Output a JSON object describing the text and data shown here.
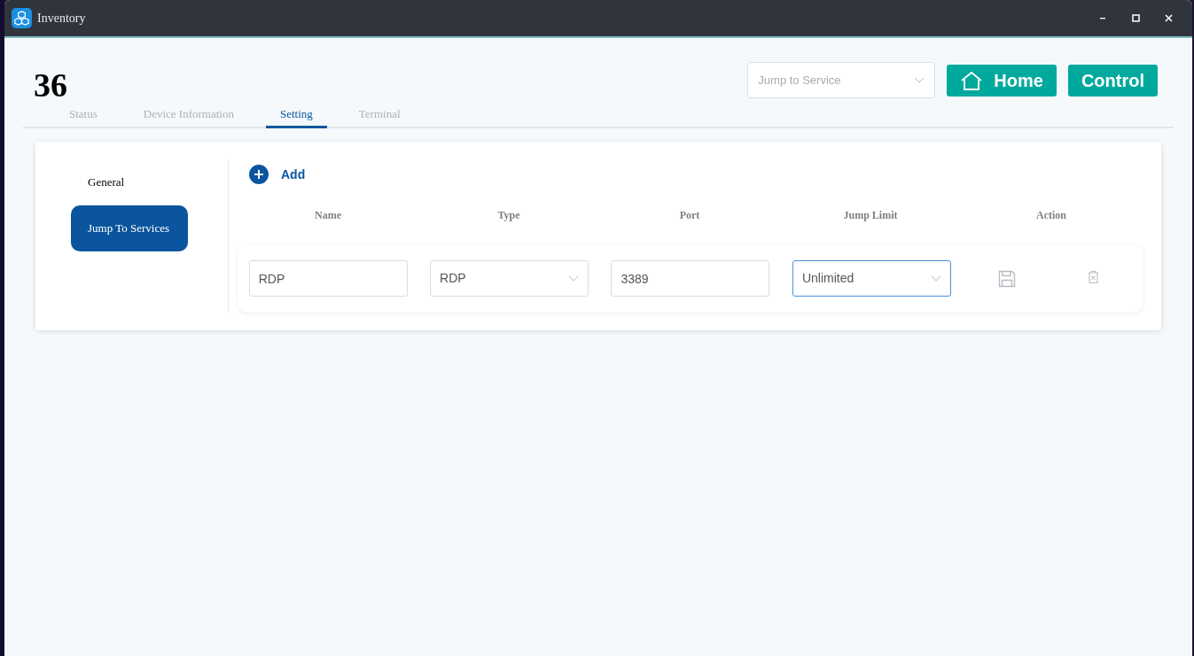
{
  "window": {
    "title": "Inventory"
  },
  "header": {
    "number": "36",
    "jump_select": {
      "placeholder": "Jump to Service"
    },
    "buttons": [
      {
        "kind": "home",
        "label": "Home"
      },
      {
        "kind": "plain",
        "label": "Control"
      }
    ]
  },
  "tabs": [
    {
      "label": "Status",
      "selected": false
    },
    {
      "label": "Device Information",
      "selected": false
    },
    {
      "label": "Setting",
      "selected": true
    },
    {
      "label": "Terminal",
      "selected": false
    }
  ],
  "side_menu": [
    {
      "label": "General",
      "selected": false
    },
    {
      "label": "Jump To Services",
      "selected": true
    }
  ],
  "add_button": {
    "label": "Add"
  },
  "table": {
    "columns": [
      "Name",
      "Type",
      "Port",
      "Jump Limit",
      "Action"
    ],
    "rows": [
      {
        "cells": [
          {
            "kind": "input",
            "value": "RDP",
            "focused": false
          },
          {
            "kind": "select",
            "value": "RDP",
            "focused": false
          },
          {
            "kind": "input",
            "value": "3389",
            "focused": false
          },
          {
            "kind": "select",
            "value": "Unlimited",
            "focused": true
          }
        ]
      }
    ]
  }
}
